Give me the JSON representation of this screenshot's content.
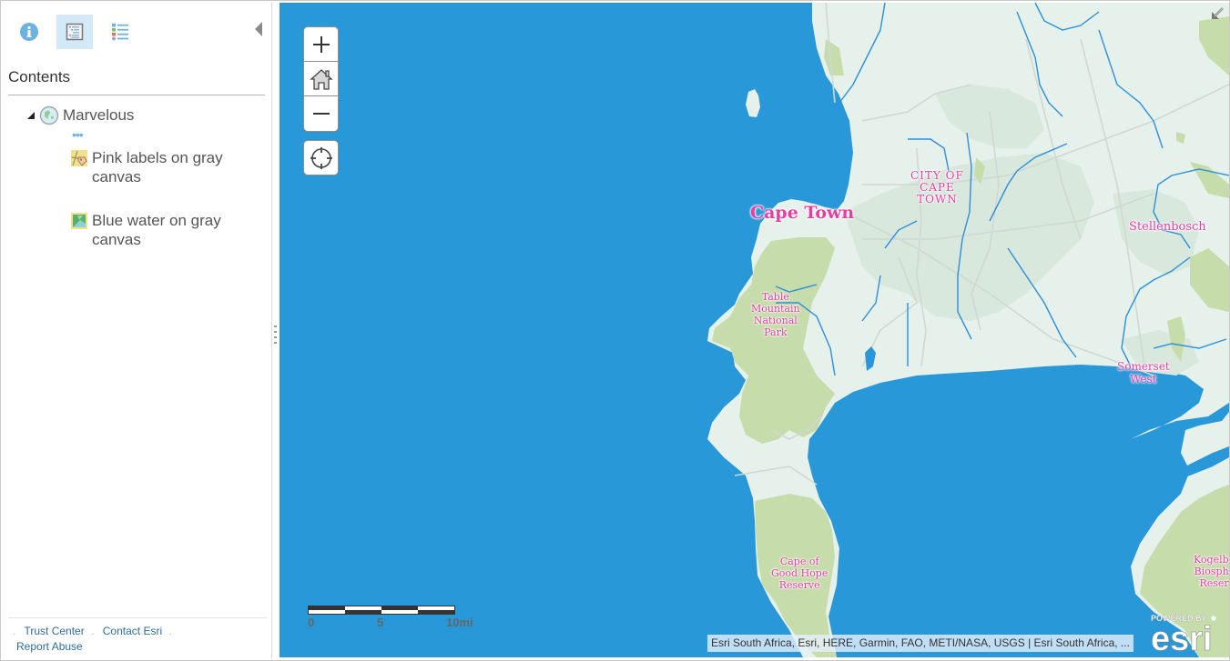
{
  "sidebar": {
    "tabs": [
      {
        "name": "About",
        "icon": "info-icon",
        "active": false
      },
      {
        "name": "Content",
        "icon": "content-icon",
        "active": true
      },
      {
        "name": "Legend",
        "icon": "legend-icon",
        "active": false
      }
    ],
    "collapse_icon": "triangle-left-icon",
    "panel_title": "Contents",
    "tree": {
      "root_label": "Marvelous",
      "root_icon": "globe-icon",
      "more_label": "•••",
      "layers": [
        {
          "label": "Pink labels on gray canvas",
          "icon": "reference-layer-icon"
        },
        {
          "label": "Blue water on gray canvas",
          "icon": "basemap-layer-icon"
        }
      ]
    },
    "footer_links": [
      "Trust Center",
      "Contact Esri",
      "Report Abuse"
    ]
  },
  "map": {
    "controls": {
      "zoom_in": "+",
      "home_icon": "home-icon",
      "zoom_out": "−",
      "locate_icon": "locate-icon",
      "expand_icon": "expand-icon"
    },
    "labels": [
      {
        "id": "cape-town",
        "text": "Cape Town"
      },
      {
        "id": "city-of-cape-town",
        "text": "CITY OF\nCAPE\nTOWN"
      },
      {
        "id": "stellenbosch",
        "text": "Stellenbosch"
      },
      {
        "id": "table-mountain",
        "text": "Table\nMountain\nNational\nPark"
      },
      {
        "id": "somerset-west",
        "text": "Somerset\nWest"
      },
      {
        "id": "cape-of-good-hope",
        "text": "Cape of\nGood Hope\nReserve"
      },
      {
        "id": "kogelberg",
        "text": "Kogelb\nBiosph\nReser"
      }
    ],
    "scalebar": {
      "labels": [
        "0",
        "5",
        "10mi"
      ]
    },
    "attribution": "Esri South Africa, Esri, HERE, Garmin, FAO, METI/NASA, USGS | Esri South Africa, ...",
    "logo": {
      "top": "POWERED BY",
      "brand": "esri"
    },
    "colors": {
      "water": "#2898d9",
      "land": "#e6f1ec",
      "urban": "#d8e8dd",
      "park": "#c6dcab",
      "river": "#2b90d8",
      "road": "#d2d9d5",
      "label": "#e83ea4"
    }
  }
}
